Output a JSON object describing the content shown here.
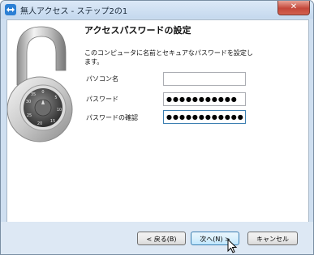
{
  "window": {
    "title": "無人アクセス - ステップ2の1",
    "close_label": "✕"
  },
  "main": {
    "heading": "アクセスパスワードの設定",
    "description": "このコンピュータに名前とセキュアなパスワードを設定します。",
    "fields": [
      {
        "label": "パソコン名",
        "value": ""
      },
      {
        "label": "パスワード",
        "value": "●●●●●●●●●●●"
      },
      {
        "label": "パスワードの確認",
        "value": "●●●●●●●●●●●●"
      }
    ]
  },
  "footer": {
    "back_label": "< 戻る(B)",
    "next_label": "次へ(N) >",
    "cancel_label": "キャンセル"
  },
  "icons": {
    "app": "teamviewer-icon",
    "hero": "combination-padlock-icon",
    "pointer": "mouse-pointer-icon"
  },
  "colors": {
    "accent": "#3c7fb1",
    "frame": "#cfdff0"
  }
}
